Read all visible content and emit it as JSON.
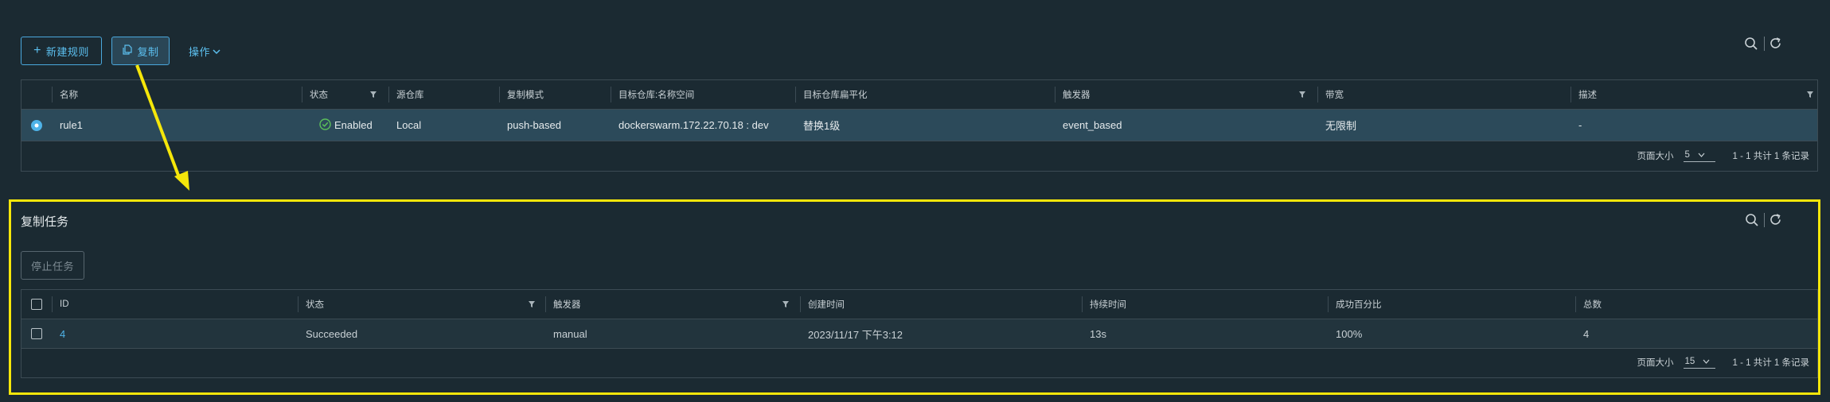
{
  "colors": {
    "background": "#1b2a32",
    "accent": "#4fb3e8",
    "selected_row": "#2c4a5a",
    "highlight": "#f5e60a",
    "success": "#5bbf5b"
  },
  "rules_toolbar": {
    "new_rule": "新建规则",
    "replicate": "复制",
    "actions": "操作"
  },
  "rules_table": {
    "headers": [
      "名称",
      "状态",
      "源仓库",
      "复制模式",
      "目标仓库:名称空间",
      "目标仓库扁平化",
      "触发器",
      "带宽",
      "描述"
    ],
    "rows": [
      {
        "name": "rule1",
        "status": "Enabled",
        "source": "Local",
        "mode": "push-based",
        "target": "dockerswarm.172.22.70.18 : dev",
        "flatten": "替换1级",
        "trigger": "event_based",
        "bandwidth": "无限制",
        "description": "-"
      }
    ],
    "footer": {
      "page_size_label": "页面大小",
      "page_size": "5",
      "summary": "1 - 1 共计 1 条记录"
    }
  },
  "tasks_section": {
    "title": "复制任务",
    "stop_button": "停止任务",
    "headers": [
      "ID",
      "状态",
      "触发器",
      "创建时间",
      "持续时间",
      "成功百分比",
      "总数"
    ],
    "rows": [
      {
        "id": "4",
        "status": "Succeeded",
        "trigger": "manual",
        "created": "2023/11/17 下午3:12",
        "duration": "13s",
        "success_rate": "100%",
        "total": "4"
      }
    ],
    "footer": {
      "page_size_label": "页面大小",
      "page_size": "15",
      "summary": "1 - 1 共计 1 条记录"
    }
  },
  "icons": {
    "search": "search-icon",
    "refresh": "refresh-icon",
    "filter": "filter-icon",
    "plus": "plus-icon",
    "copy": "copy-icon",
    "chevron": "chevron-down-icon",
    "check": "check-circle-icon"
  }
}
